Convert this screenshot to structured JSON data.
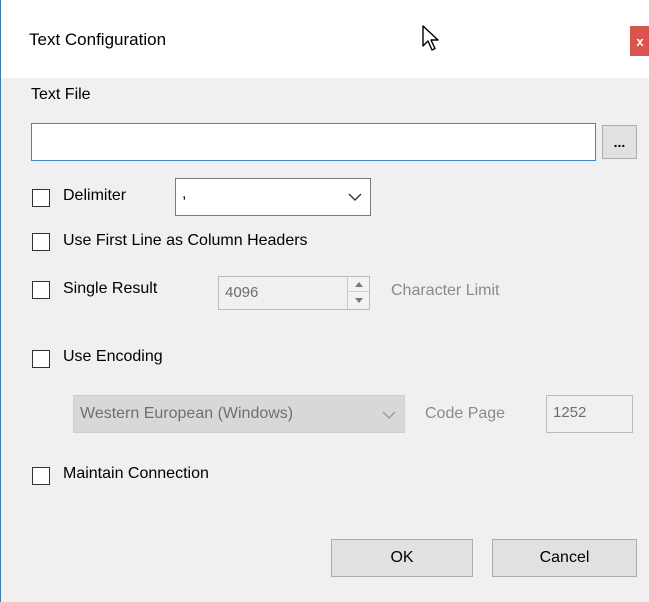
{
  "window": {
    "title": "Text Configuration",
    "close_label": "x"
  },
  "text_file": {
    "label": "Text File",
    "value": "",
    "browse_label": "..."
  },
  "delimiter": {
    "label": "Delimiter",
    "checked": false,
    "selected": ","
  },
  "first_line": {
    "label": "Use First Line as Column Headers",
    "checked": false
  },
  "single_result": {
    "label": "Single Result",
    "checked": false,
    "limit_value": "4096",
    "limit_label": "Character Limit"
  },
  "encoding": {
    "label": "Use Encoding",
    "checked": false,
    "selected": "Western European (Windows)",
    "code_page_label": "Code Page",
    "code_page_value": "1252"
  },
  "maintain_connection": {
    "label": "Maintain Connection",
    "checked": false
  },
  "buttons": {
    "ok": "OK",
    "cancel": "Cancel"
  },
  "colors": {
    "accent": "#3f86c8",
    "close": "#d9534f",
    "disabled_text": "#8a8a8a"
  }
}
